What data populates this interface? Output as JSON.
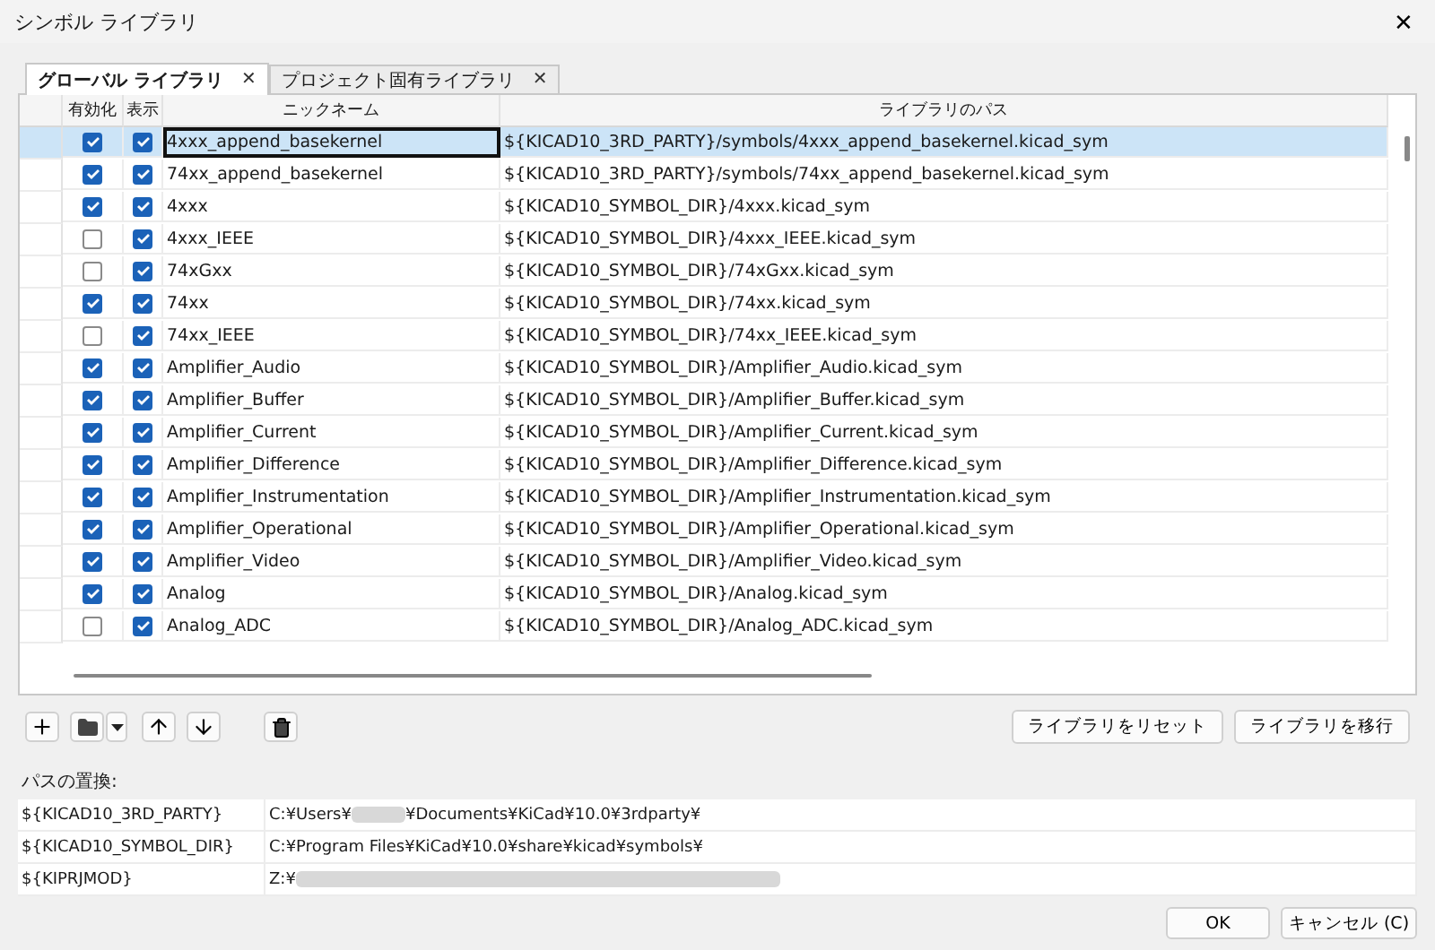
{
  "window": {
    "title": "シンボル ライブラリ",
    "close": "✕"
  },
  "tabs": [
    {
      "label": "グローバル ライブラリ",
      "close": "✕",
      "selected": true
    },
    {
      "label": "プロジェクト固有ライブラリ",
      "close": "✕",
      "selected": false
    }
  ],
  "table": {
    "columns": [
      "有効化",
      "表示",
      "ニックネーム",
      "ライブラリのパス"
    ],
    "rows": [
      {
        "enabled": true,
        "visible": true,
        "nickname": "4xxx_append_basekernel",
        "path": "${KICAD10_3RD_PARTY}/symbols/4xxx_append_basekernel.kicad_sym",
        "selected": true
      },
      {
        "enabled": true,
        "visible": true,
        "nickname": "74xx_append_basekernel",
        "path": "${KICAD10_3RD_PARTY}/symbols/74xx_append_basekernel.kicad_sym",
        "selected": false
      },
      {
        "enabled": true,
        "visible": true,
        "nickname": "4xxx",
        "path": "${KICAD10_SYMBOL_DIR}/4xxx.kicad_sym",
        "selected": false
      },
      {
        "enabled": false,
        "visible": true,
        "nickname": "4xxx_IEEE",
        "path": "${KICAD10_SYMBOL_DIR}/4xxx_IEEE.kicad_sym",
        "selected": false
      },
      {
        "enabled": false,
        "visible": true,
        "nickname": "74xGxx",
        "path": "${KICAD10_SYMBOL_DIR}/74xGxx.kicad_sym",
        "selected": false
      },
      {
        "enabled": true,
        "visible": true,
        "nickname": "74xx",
        "path": "${KICAD10_SYMBOL_DIR}/74xx.kicad_sym",
        "selected": false
      },
      {
        "enabled": false,
        "visible": true,
        "nickname": "74xx_IEEE",
        "path": "${KICAD10_SYMBOL_DIR}/74xx_IEEE.kicad_sym",
        "selected": false
      },
      {
        "enabled": true,
        "visible": true,
        "nickname": "Amplifier_Audio",
        "path": "${KICAD10_SYMBOL_DIR}/Amplifier_Audio.kicad_sym",
        "selected": false
      },
      {
        "enabled": true,
        "visible": true,
        "nickname": "Amplifier_Buffer",
        "path": "${KICAD10_SYMBOL_DIR}/Amplifier_Buffer.kicad_sym",
        "selected": false
      },
      {
        "enabled": true,
        "visible": true,
        "nickname": "Amplifier_Current",
        "path": "${KICAD10_SYMBOL_DIR}/Amplifier_Current.kicad_sym",
        "selected": false
      },
      {
        "enabled": true,
        "visible": true,
        "nickname": "Amplifier_Difference",
        "path": "${KICAD10_SYMBOL_DIR}/Amplifier_Difference.kicad_sym",
        "selected": false
      },
      {
        "enabled": true,
        "visible": true,
        "nickname": "Amplifier_Instrumentation",
        "path": "${KICAD10_SYMBOL_DIR}/Amplifier_Instrumentation.kicad_sym",
        "selected": false
      },
      {
        "enabled": true,
        "visible": true,
        "nickname": "Amplifier_Operational",
        "path": "${KICAD10_SYMBOL_DIR}/Amplifier_Operational.kicad_sym",
        "selected": false
      },
      {
        "enabled": true,
        "visible": true,
        "nickname": "Amplifier_Video",
        "path": "${KICAD10_SYMBOL_DIR}/Amplifier_Video.kicad_sym",
        "selected": false
      },
      {
        "enabled": true,
        "visible": true,
        "nickname": "Analog",
        "path": "${KICAD10_SYMBOL_DIR}/Analog.kicad_sym",
        "selected": false
      },
      {
        "enabled": false,
        "visible": true,
        "nickname": "Analog_ADC",
        "path": "${KICAD10_SYMBOL_DIR}/Analog_ADC.kicad_sym",
        "selected": false
      }
    ]
  },
  "toolbar": {
    "right_buttons": [
      "ライブラリをリセット",
      "ライブラリを移行"
    ]
  },
  "path_substitutions": {
    "label": "パスの置換:",
    "rows": [
      {
        "name": "${KICAD10_3RD_PARTY}",
        "parts": [
          {
            "kind": "text",
            "text": "C:¥Users¥"
          },
          {
            "kind": "redacted"
          },
          {
            "kind": "text",
            "text": "¥Documents¥KiCad¥10.0¥3rdparty¥"
          }
        ]
      },
      {
        "name": "${KICAD10_SYMBOL_DIR}",
        "parts": [
          {
            "kind": "text",
            "text": "C:¥Program Files¥KiCad¥10.0¥share¥kicad¥symbols¥"
          }
        ]
      },
      {
        "name": "${KIPRJMOD}",
        "parts": [
          {
            "kind": "text",
            "text": "Z:¥"
          },
          {
            "kind": "redacted_long"
          }
        ]
      }
    ]
  },
  "buttons": {
    "ok": "OK",
    "cancel": "キャンセル (C)"
  }
}
